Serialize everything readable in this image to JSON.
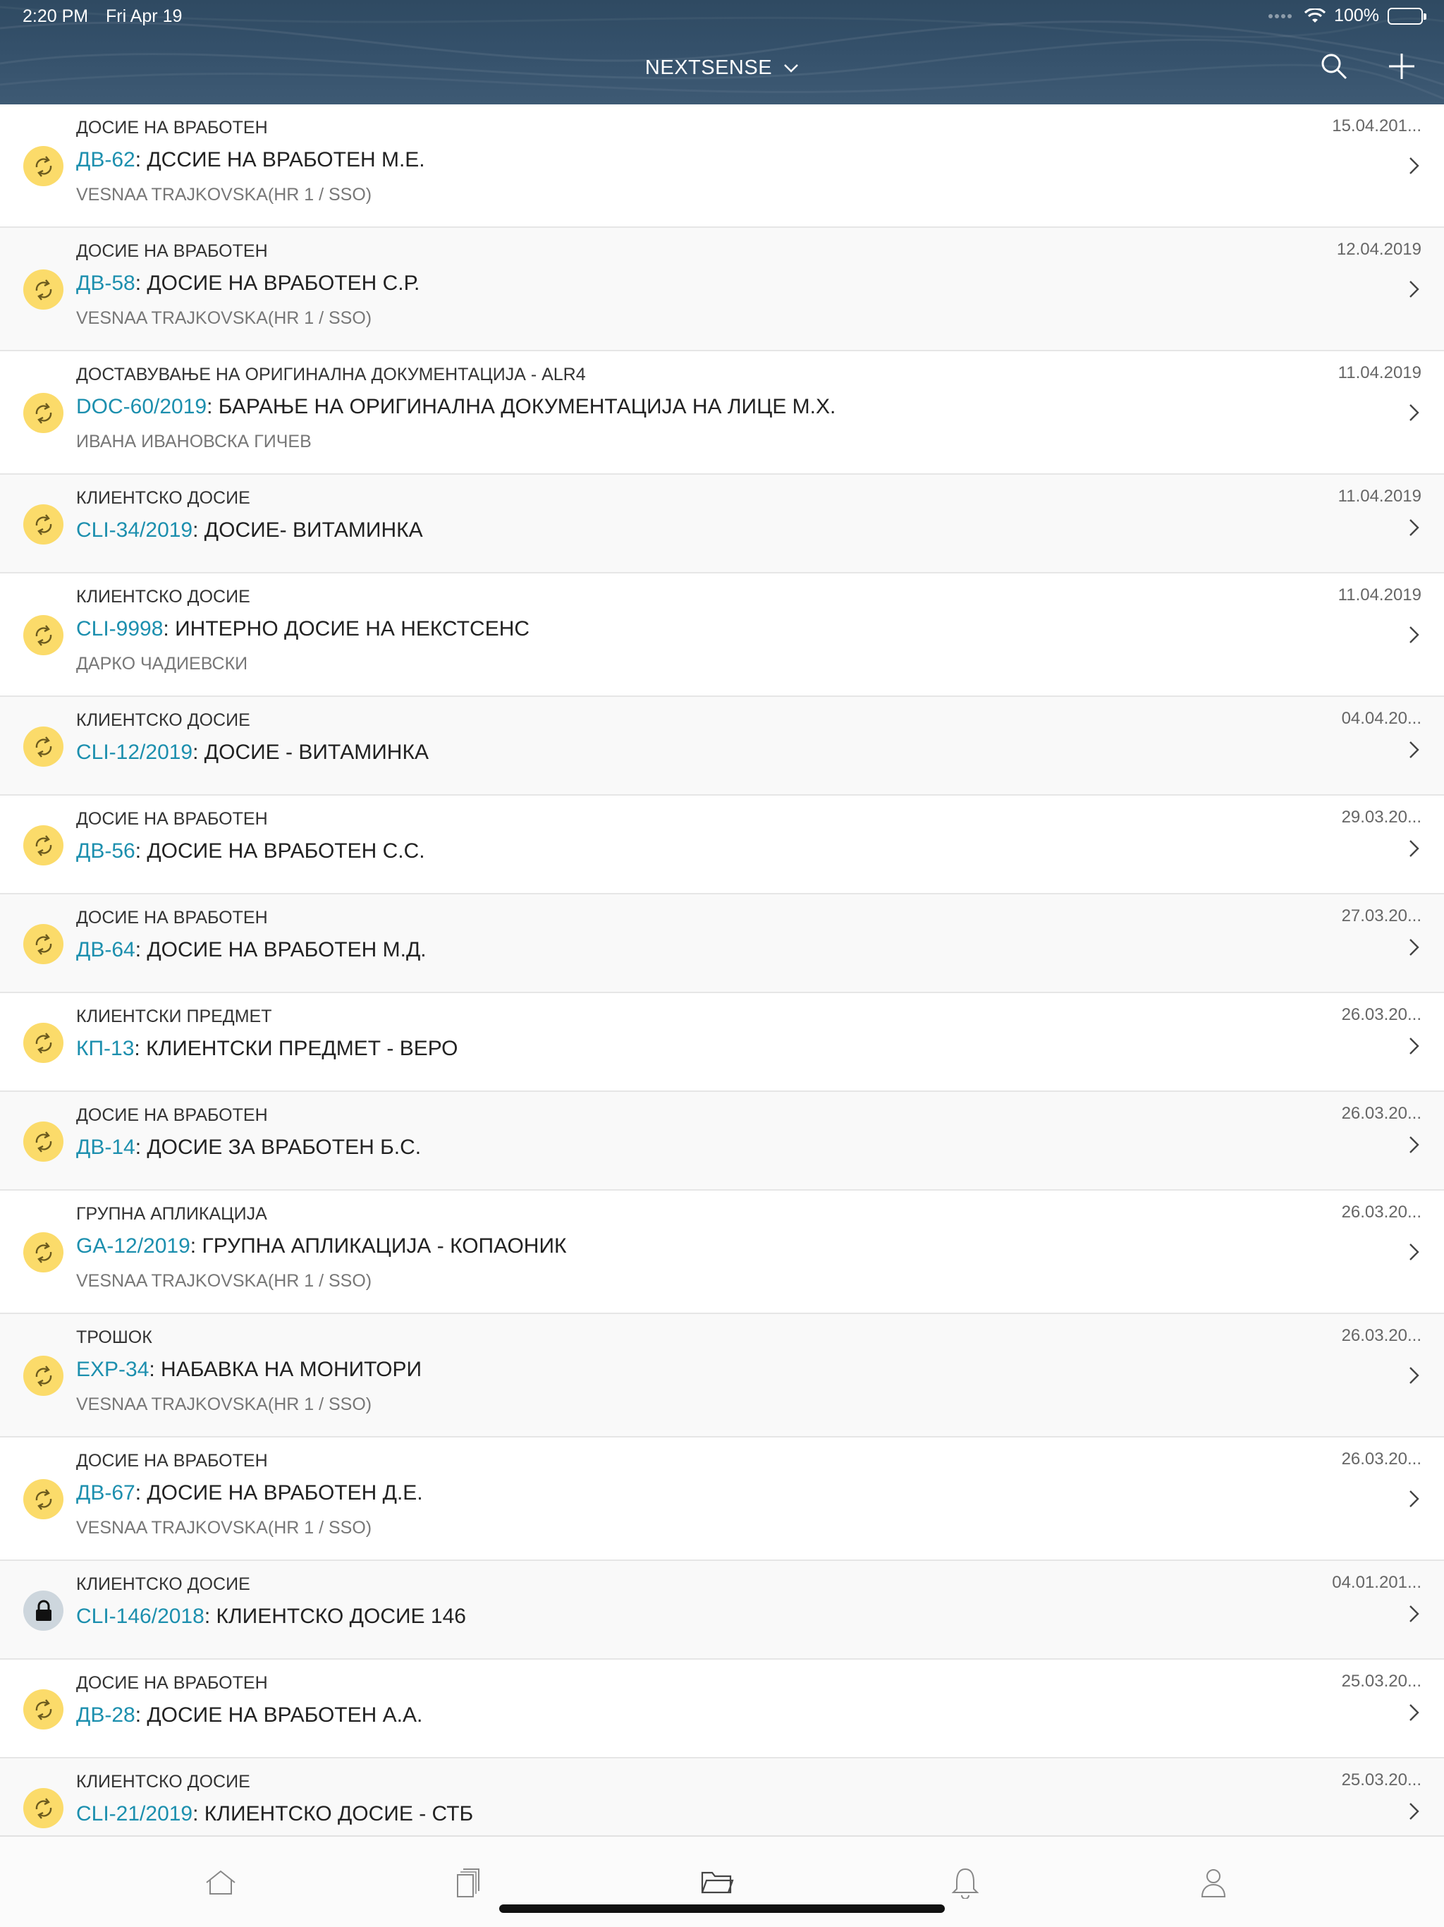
{
  "status_bar": {
    "time": "2:20 PM",
    "date": "Fri Apr 19",
    "battery": "100%"
  },
  "header": {
    "title": "NEXTSENSE",
    "search_icon": "search-icon",
    "add_icon": "plus-icon",
    "colors": {
      "background": "#34506a",
      "text": "#ffffff"
    }
  },
  "colors": {
    "code_link": "#1c8fae",
    "status_pending": "#fbdb6a",
    "status_locked": "#cdd6dd"
  },
  "items": [
    {
      "category": "ДОСИЕ НА ВРАБОТЕН",
      "code": "ДВ-62",
      "title": ": ДССИЕ НА ВРАБОТЕН М.Е.",
      "author": "VESNAA TRAJKOVSKA(HR 1 / SSO)",
      "date": "15.04.201...",
      "status_icon": "sync-icon"
    },
    {
      "category": "ДОСИЕ НА ВРАБОТЕН",
      "code": "ДВ-58",
      "title": ": ДОСИЕ НА ВРАБОТЕН С.Р.",
      "author": "VESNAA TRAJKOVSKA(HR 1 / SSO)",
      "date": "12.04.2019",
      "status_icon": "sync-icon"
    },
    {
      "category": "ДОСТАВУВАЊЕ НА ОРИГИНАЛНА ДОКУМЕНТАЦИЈА - ALR4",
      "code": "DOC-60/2019",
      "title": ": БАРАЊЕ НА ОРИГИНАЛНА ДОКУМЕНТАЦИЈА НА ЛИЦЕ М.Х.",
      "author": "ИВАНА ИВАНОВСКА ГИЧЕВ",
      "date": "11.04.2019",
      "status_icon": "sync-icon"
    },
    {
      "category": "КЛИЕНТСКО ДОСИЕ",
      "code": "CLI-34/2019",
      "title": ": ДОСИЕ- ВИТАМИНКА",
      "author": "",
      "date": "11.04.2019",
      "status_icon": "sync-icon"
    },
    {
      "category": "КЛИЕНТСКО ДОСИЕ",
      "code": "CLI-9998",
      "title": ": ИНТЕРНО ДОСИЕ НА НЕКСТСЕНС",
      "author": "ДАРКО ЧАДИЕВСКИ",
      "date": "11.04.2019",
      "status_icon": "sync-icon"
    },
    {
      "category": "КЛИЕНТСКО ДОСИЕ",
      "code": "CLI-12/2019",
      "title": ": ДОСИЕ - ВИТАМИНКА",
      "author": "",
      "date": "04.04.20...",
      "status_icon": "sync-icon"
    },
    {
      "category": "ДОСИЕ НА ВРАБОТЕН",
      "code": "ДВ-56",
      "title": ": ДОСИЕ НА ВРАБОТЕН С.С.",
      "author": "",
      "date": "29.03.20...",
      "status_icon": "sync-icon"
    },
    {
      "category": "ДОСИЕ НА ВРАБОТЕН",
      "code": "ДВ-64",
      "title": ": ДОСИЕ НА ВРАБОТЕН М.Д.",
      "author": "",
      "date": "27.03.20...",
      "status_icon": "sync-icon"
    },
    {
      "category": "КЛИЕНТСКИ ПРЕДМЕТ",
      "code": "КП-13",
      "title": ": КЛИЕНТСКИ ПРЕДМЕТ - ВЕРО",
      "author": "",
      "date": "26.03.20...",
      "status_icon": "sync-icon"
    },
    {
      "category": "ДОСИЕ НА ВРАБОТЕН",
      "code": "ДВ-14",
      "title": ": ДОСИЕ ЗА ВРАБОТЕН Б.С.",
      "author": "",
      "date": "26.03.20...",
      "status_icon": "sync-icon"
    },
    {
      "category": "ГРУПНА АПЛИКАЦИЈА",
      "code": "GA-12/2019",
      "title": ": ГРУПНА АПЛИКАЦИЈА - КОПАОНИК",
      "author": "VESNAA TRAJKOVSKA(HR 1 / SSO)",
      "date": "26.03.20...",
      "status_icon": "sync-icon"
    },
    {
      "category": "ТРОШОК",
      "code": "EXP-34",
      "title": ": НАБАВКА НА МОНИТОРИ",
      "author": "VESNAA TRAJKOVSKA(HR 1 / SSO)",
      "date": "26.03.20...",
      "status_icon": "sync-icon"
    },
    {
      "category": "ДОСИЕ НА ВРАБОТЕН",
      "code": "ДВ-67",
      "title": ": ДОСИЕ НА ВРАБОТЕН Д.Е.",
      "author": "VESNAA TRAJKOVSKA(HR 1 / SSO)",
      "date": "26.03.20...",
      "status_icon": "sync-icon"
    },
    {
      "category": "КЛИЕНТСКО ДОСИЕ",
      "code": "CLI-146/2018",
      "title": ": КЛИЕНТСКО ДОСИЕ 146",
      "author": "",
      "date": "04.01.201...",
      "status_icon": "lock-icon"
    },
    {
      "category": "ДОСИЕ НА ВРАБОТЕН",
      "code": "ДВ-28",
      "title": ": ДОСИЕ НА ВРАБОТЕН А.А.",
      "author": "",
      "date": "25.03.20...",
      "status_icon": "sync-icon"
    },
    {
      "category": "КЛИЕНТСКО ДОСИЕ",
      "code": "CLI-21/2019",
      "title": ": КЛИЕНТСКО ДОСИЕ - СТБ",
      "author": "",
      "date": "25.03.20...",
      "status_icon": "sync-icon"
    }
  ],
  "tabbar": {
    "tabs": [
      {
        "icon": "home-icon"
      },
      {
        "icon": "documents-icon"
      },
      {
        "icon": "folder-icon",
        "active": true
      },
      {
        "icon": "bell-icon"
      },
      {
        "icon": "user-icon"
      }
    ]
  }
}
